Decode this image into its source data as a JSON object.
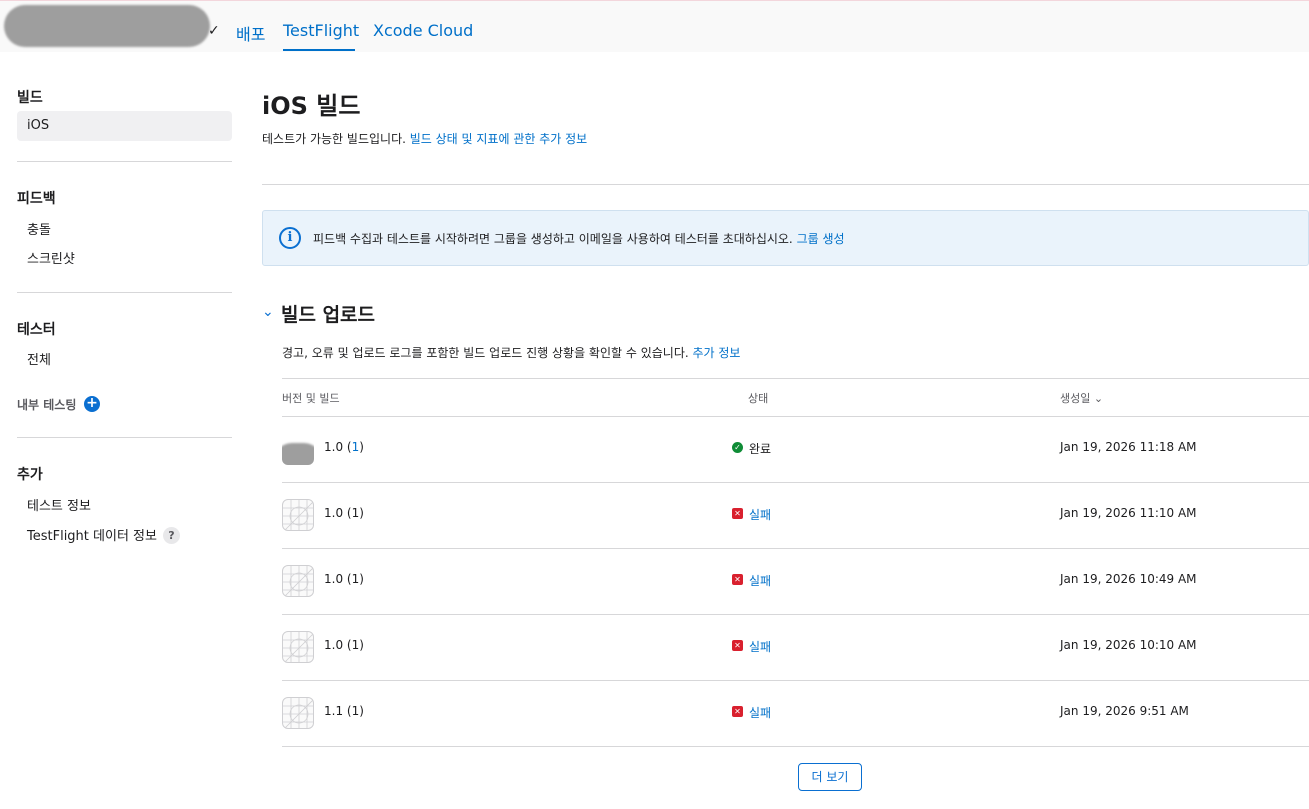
{
  "header": {
    "tabs": [
      {
        "label": "배포",
        "active": false
      },
      {
        "label": "TestFlight",
        "active": true
      },
      {
        "label": "Xcode Cloud",
        "active": false
      }
    ]
  },
  "sidebar": {
    "builds_heading": "빌드",
    "builds_items": [
      "iOS"
    ],
    "feedback_heading": "피드백",
    "feedback_items": [
      "충돌",
      "스크린샷"
    ],
    "testers_heading": "테스터",
    "testers_items": [
      "전체"
    ],
    "internal_testing_label": "내부 테스팅",
    "extra_heading": "추가",
    "extra_items": [
      "테스트 정보",
      "TestFlight 데이터 정보"
    ]
  },
  "main": {
    "title": "iOS 빌드",
    "description": "테스트가 가능한 빌드입니다. ",
    "description_link": "빌드 상태 및 지표에 관한 추가 정보",
    "banner_text": "피드백 수집과 테스트를 시작하려면 그룹을 생성하고 이메일을 사용하여 테스터를 초대하십시오. ",
    "banner_link": "그룹 생성",
    "section_title": "빌드 업로드",
    "section_desc": "경고, 오류 및 업로드 로그를 포함한 빌드 업로드 진행 상황을 확인할 수 있습니다. ",
    "section_link": "추가 정보",
    "table": {
      "columns": [
        "버전 및 빌드",
        "상태",
        "생성일"
      ],
      "sort_indicator": "⌄",
      "rows": [
        {
          "version": "1.0",
          "build": "1",
          "status": "완료",
          "status_type": "ok",
          "date": "Jan 19, 2026 11:18 AM"
        },
        {
          "version": "1.0",
          "build": "1",
          "status": "실패",
          "status_type": "fail",
          "date": "Jan 19, 2026 11:10 AM"
        },
        {
          "version": "1.0",
          "build": "1",
          "status": "실패",
          "status_type": "fail",
          "date": "Jan 19, 2026 10:49 AM"
        },
        {
          "version": "1.0",
          "build": "1",
          "status": "실패",
          "status_type": "fail",
          "date": "Jan 19, 2026 10:10 AM"
        },
        {
          "version": "1.1",
          "build": "1",
          "status": "실패",
          "status_type": "fail",
          "date": "Jan 19, 2026 9:51 AM"
        }
      ]
    },
    "more_button": "더 보기"
  },
  "colors": {
    "accent": "#0070c9",
    "success": "#0f8c36",
    "failure": "#d9202e",
    "banner_bg": "#eaf3fb"
  }
}
